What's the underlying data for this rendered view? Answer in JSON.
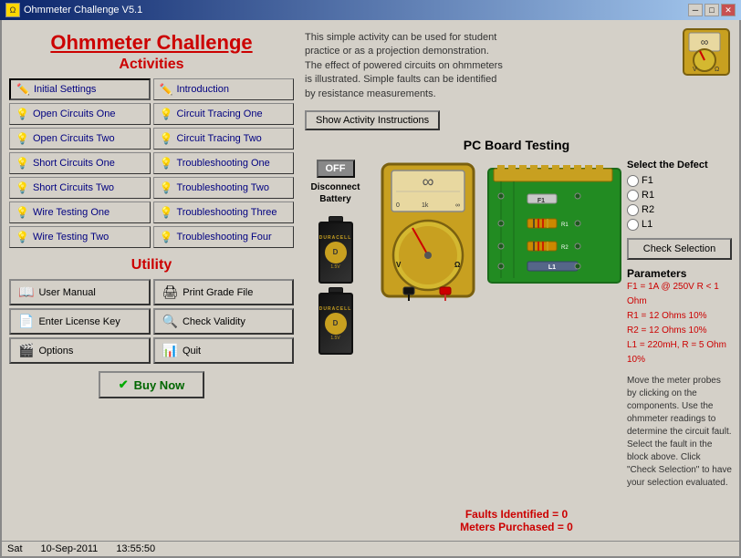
{
  "titleBar": {
    "title": "Ohmmeter Challenge V5.1",
    "minBtn": "─",
    "maxBtn": "□",
    "closeBtn": "✕",
    "icon": "Ω"
  },
  "header": {
    "appTitle": "Ohmmeter Challenge",
    "activitiesTitle": "Activities"
  },
  "activities": {
    "col1": [
      {
        "label": "Initial Settings",
        "icon": "pencil",
        "selected": true
      },
      {
        "label": "Open Circuits One",
        "icon": "light"
      },
      {
        "label": "Open Circuits Two",
        "icon": "light"
      },
      {
        "label": "Short Circuits One",
        "icon": "light"
      },
      {
        "label": "Short Circuits Two",
        "icon": "light"
      },
      {
        "label": "Wire Testing One",
        "icon": "light"
      },
      {
        "label": "Wire Testing Two",
        "icon": "light"
      }
    ],
    "col2": [
      {
        "label": "Introduction",
        "icon": "pencil"
      },
      {
        "label": "Circuit Tracing One",
        "icon": "light"
      },
      {
        "label": "Circuit Tracing Two",
        "icon": "light"
      },
      {
        "label": "Troubleshooting One",
        "icon": "light"
      },
      {
        "label": "Troubleshooting Two",
        "icon": "light"
      },
      {
        "label": "Troubleshooting Three",
        "icon": "light"
      },
      {
        "label": "Troubleshooting Four",
        "icon": "light"
      }
    ]
  },
  "utility": {
    "title": "Utility",
    "buttons": [
      {
        "label": "User Manual",
        "icon": "📖"
      },
      {
        "label": "Print Grade File",
        "icon": "🖨"
      },
      {
        "label": "Enter License Key",
        "icon": "📄"
      },
      {
        "label": "Check Validity",
        "icon": "🔍"
      },
      {
        "label": "Options",
        "icon": "🎬"
      },
      {
        "label": "Quit",
        "icon": "📊"
      }
    ],
    "buyBtn": "Buy Now"
  },
  "description": {
    "text": "This simple activity can be used for student practice or as a projection demonstration. The effect of powered circuits on ohmmeters is illustrated. Simple faults can be identified by resistance measurements.",
    "instructionsBtn": "Show Activity Instructions"
  },
  "pcBoard": {
    "title": "PC Board Testing",
    "offBtn": "OFF",
    "disconnectLabel": "Disconnect\nBattery",
    "battery1Brand": "DURACELL",
    "battery2Brand": "DURACELL",
    "meterSymbol": "∞",
    "meterLabels": {
      "left": "V",
      "right": "Ω"
    },
    "defect": {
      "title": "Select the Defect",
      "options": [
        "F1",
        "R1",
        "R2",
        "L1"
      ]
    },
    "checkBtn": "Check Selection",
    "params": {
      "title": "Parameters",
      "lines": [
        "F1 = 1A @ 250V  R < 1 Ohm",
        "R1 = 12 Ohms  10%",
        "R2 = 12 Ohms  10%",
        "L1 = 220mH,  R = 5 Ohm 10%"
      ]
    },
    "faults": "Faults Identified = 0",
    "meters": "Meters Purchased = 0",
    "instructionText": "Move the meter probes by clicking on the components. Use the ohmmeter readings to determine the circuit fault. Select the fault in the block above. Click \"Check Selection\" to have your selection evaluated."
  },
  "statusBar": {
    "day": "Sat",
    "date": "10-Sep-2011",
    "time": "13:55:50"
  }
}
